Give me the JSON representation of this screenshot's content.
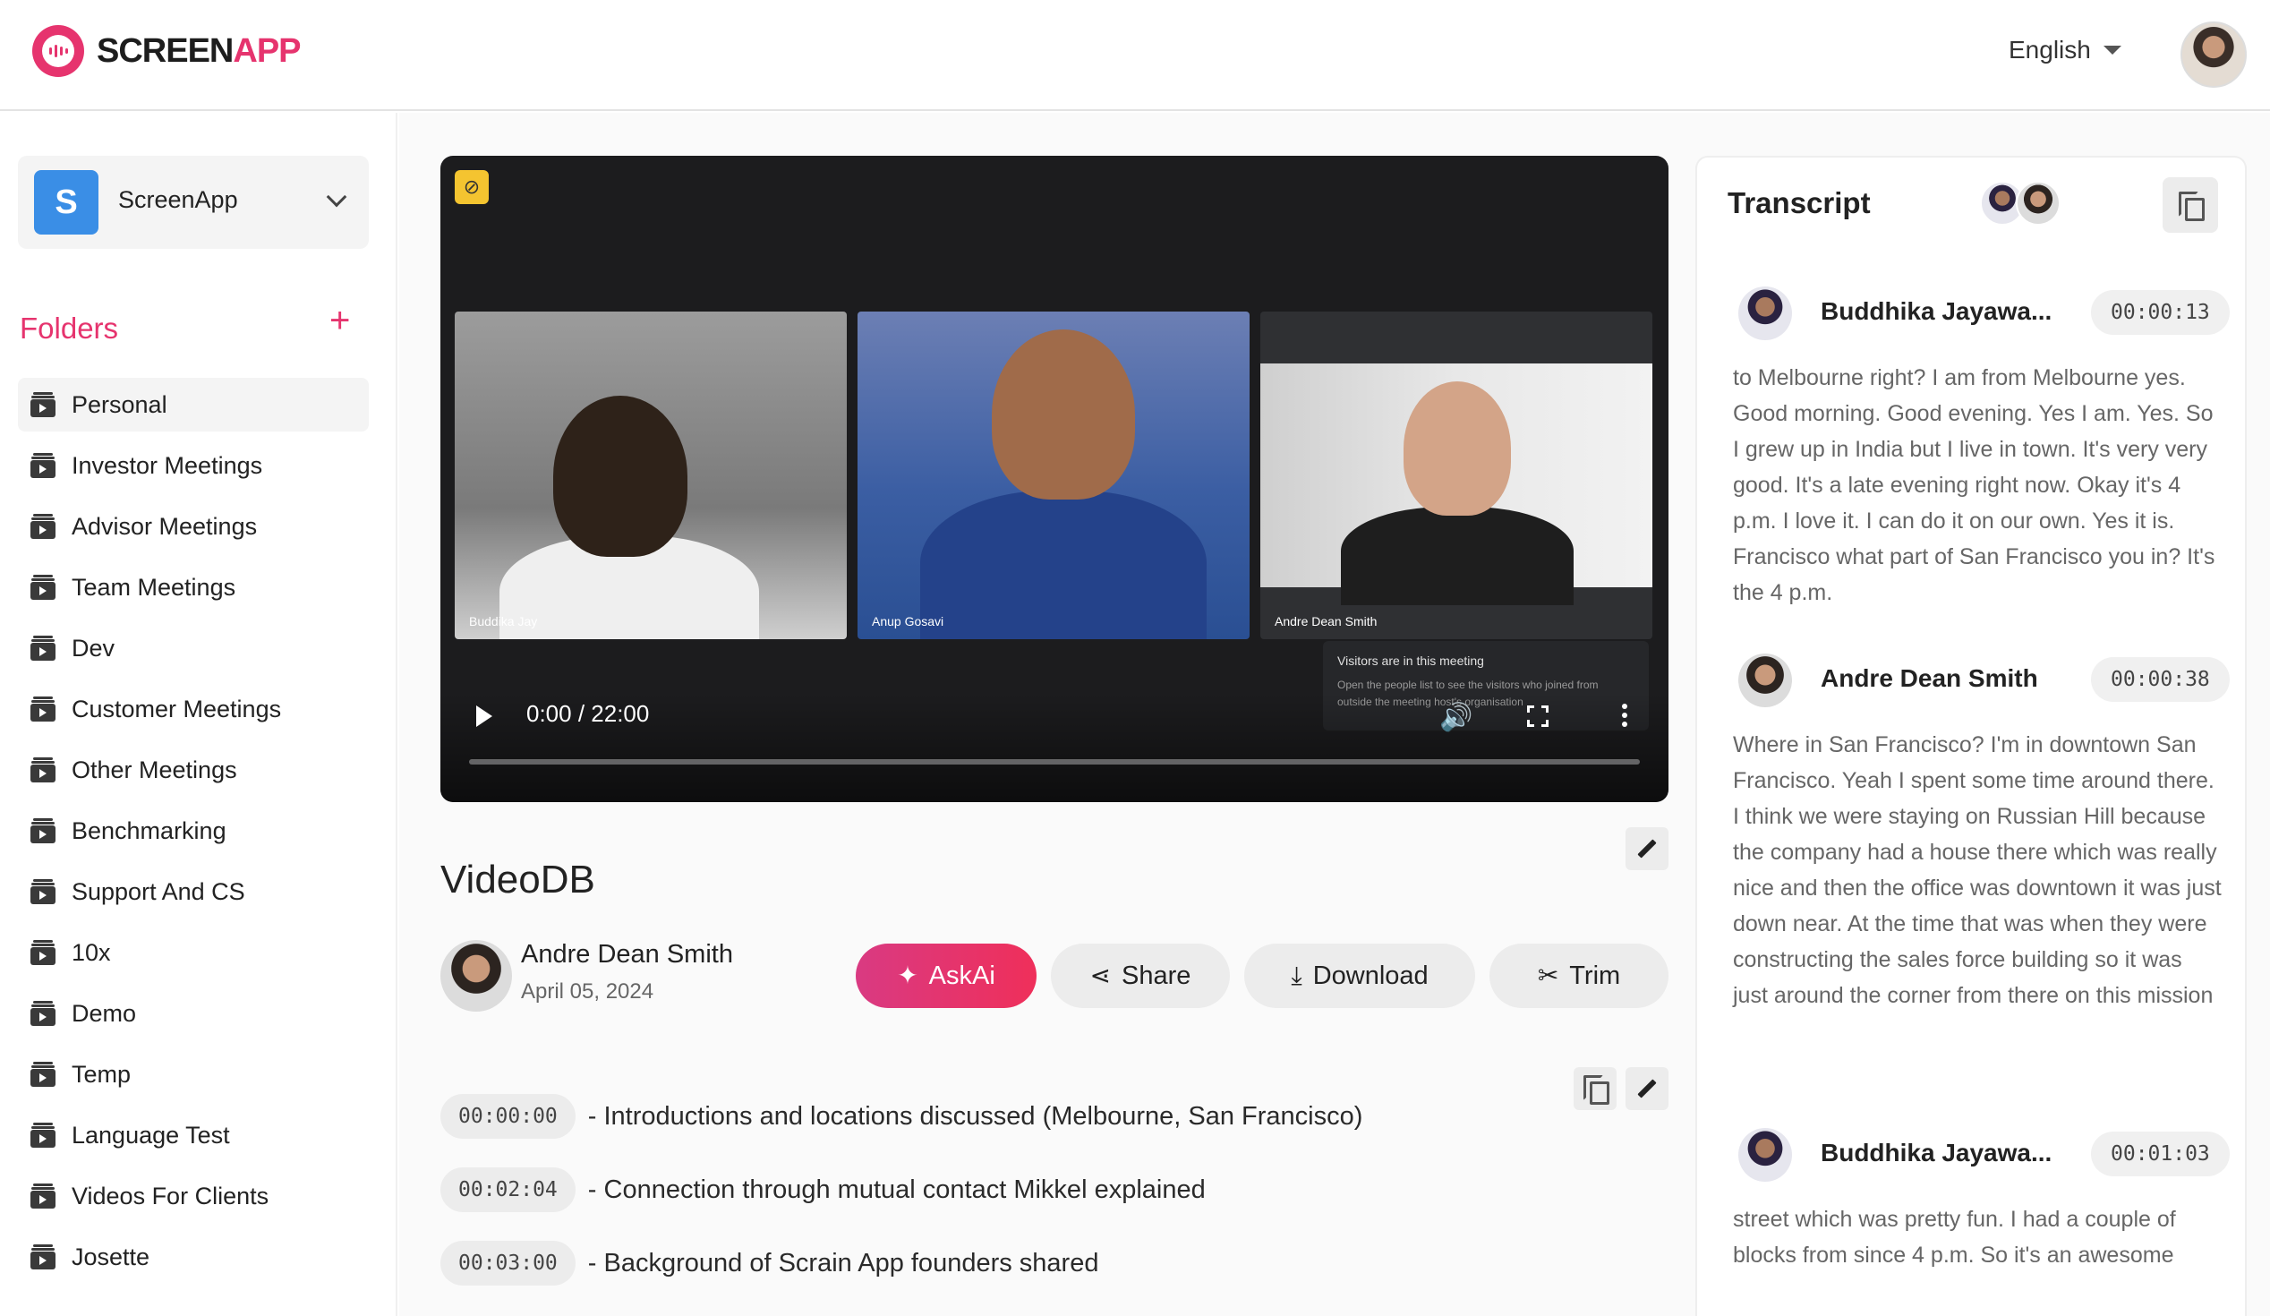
{
  "app": {
    "logo_part1": "SCREEN",
    "logo_part2": "APP",
    "language": "English"
  },
  "sidebar": {
    "workspace_initial": "S",
    "workspace_name": "ScreenApp",
    "folders_title": "Folders",
    "add_symbol": "+",
    "folders": [
      "Personal",
      "Investor Meetings",
      "Advisor Meetings",
      "Team Meetings",
      "Dev",
      "Customer Meetings",
      "Other Meetings",
      "Benchmarking",
      "Support And CS",
      "10x",
      "Demo",
      "Temp",
      "Language Test",
      "Videos For Clients",
      "Josette"
    ],
    "active_folder": "Personal"
  },
  "video": {
    "participants": [
      "Buddika Jay",
      "Anup Gosavi",
      "Andre Dean Smith"
    ],
    "visitors_title": "Visitors are in this meeting",
    "visitors_sub": "Open the people list to see the visitors who joined from outside the meeting host's organisation",
    "time_current": "0:00",
    "time_total": "22:00",
    "progress": 0
  },
  "recording": {
    "title": "VideoDB",
    "author": "Andre Dean Smith",
    "date": "April 05, 2024"
  },
  "actions": {
    "askai": "AskAi",
    "share": "Share",
    "download": "Download",
    "trim": "Trim"
  },
  "summary": [
    {
      "ts": "00:00:00",
      "text": "- Introductions and locations discussed (Melbourne, San Francisco)"
    },
    {
      "ts": "00:02:04",
      "text": "- Connection through mutual contact Mikkel explained"
    },
    {
      "ts": "00:03:00",
      "text": "- Background of Scrain App founders shared"
    }
  ],
  "transcript": {
    "title": "Transcript",
    "entries": [
      {
        "speaker": "Buddhika Jayawa...",
        "ts": "00:00:13",
        "text": "to Melbourne right? I am from Melbourne yes. Good morning. Good evening. Yes I am. Yes. So I grew up in India but I live in town. It's very very good. It's a late evening right now. Okay it's 4 p.m. I love it. I can do it on our own. Yes it is. Francisco what part of San Francisco you in? It's the 4 p.m."
      },
      {
        "speaker": "Andre Dean Smith",
        "ts": "00:00:38",
        "text": "Where in San Francisco? I'm in downtown San Francisco. Yeah I spent some time around there. I think we were staying on Russian Hill because the company had a house there which was really nice and then the office was downtown it was just down near. At the time that was when they were constructing the sales force building so it was just around the corner from there on this mission"
      },
      {
        "speaker": "Buddhika Jayawa...",
        "ts": "00:01:03",
        "text": "street which was pretty fun. I had a couple of blocks from since 4 p.m. So it's an awesome"
      }
    ]
  },
  "colors": {
    "accent": "#e6346e",
    "workspace_badge": "#3a8ee6",
    "record_badge": "#f4c430"
  }
}
